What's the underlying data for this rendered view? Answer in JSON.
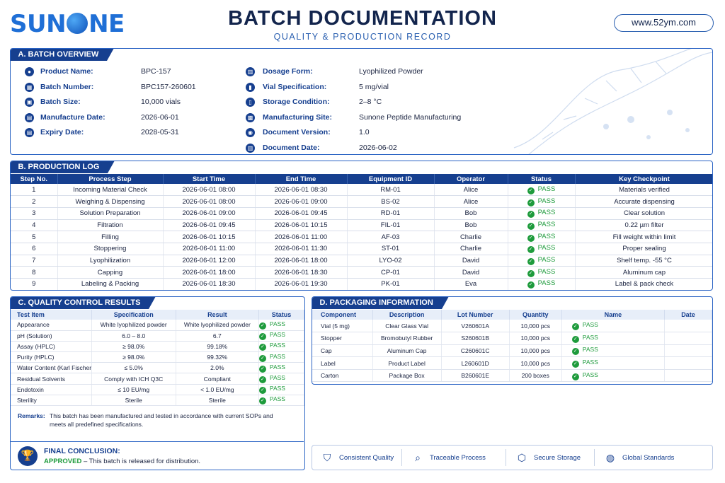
{
  "header": {
    "logo_text_1": "SUN",
    "logo_text_2": "NE",
    "title": "BATCH DOCUMENTATION",
    "subtitle": "QUALITY & PRODUCTION RECORD",
    "url": "www.52ym.com"
  },
  "overview": {
    "section_title": "A. BATCH OVERVIEW",
    "left": [
      {
        "icon": "person-icon",
        "label": "Product Name:",
        "value": "BPC-157"
      },
      {
        "icon": "barcode-icon",
        "label": "Batch Number:",
        "value": "BPC157-260601"
      },
      {
        "icon": "box-icon",
        "label": "Batch Size:",
        "value": "10,000 vials"
      },
      {
        "icon": "calendar-icon",
        "label": "Manufacture Date:",
        "value": "2026-06-01"
      },
      {
        "icon": "calendar-icon",
        "label": "Expiry Date:",
        "value": "2028-05-31"
      }
    ],
    "right": [
      {
        "icon": "document-icon",
        "label": "Dosage Form:",
        "value": "Lyophilized Powder"
      },
      {
        "icon": "vial-icon",
        "label": "Vial Specification:",
        "value": "5 mg/vial"
      },
      {
        "icon": "thermometer-icon",
        "label": "Storage Condition:",
        "value": "2–8 °C"
      },
      {
        "icon": "factory-icon",
        "label": "Manufacturing Site:",
        "value": "Sunone Peptide Manufacturing"
      },
      {
        "icon": "version-icon",
        "label": "Document Version:",
        "value": "1.0"
      },
      {
        "icon": "document-icon",
        "label": "Document Date:",
        "value": "2026-06-02"
      }
    ]
  },
  "production": {
    "section_title": "B. PRODUCTION LOG",
    "headers": [
      "Step No.",
      "Process Step",
      "Start Time",
      "End Time",
      "Equipment ID",
      "Operator",
      "Status",
      "Key Checkpoint"
    ],
    "rows": [
      [
        "1",
        "Incoming Material Check",
        "2026-06-01 08:00",
        "2026-06-01 08:30",
        "RM-01",
        "Alice",
        "PASS",
        "Materials verified"
      ],
      [
        "2",
        "Weighing & Dispensing",
        "2026-06-01 08:00",
        "2026-06-01 09:00",
        "BS-02",
        "Alice",
        "PASS",
        "Accurate dispensing"
      ],
      [
        "3",
        "Solution Preparation",
        "2026-06-01 09:00",
        "2026-06-01 09:45",
        "RD-01",
        "Bob",
        "PASS",
        "Clear solution"
      ],
      [
        "4",
        "Filtration",
        "2026-06-01 09:45",
        "2026-06-01 10:15",
        "FIL-01",
        "Bob",
        "PASS",
        "0.22 µm filter"
      ],
      [
        "5",
        "Filling",
        "2026-06-01 10:15",
        "2026-06-01 11:00",
        "AF-03",
        "Charlie",
        "PASS",
        "Fill weight within limit"
      ],
      [
        "6",
        "Stoppering",
        "2026-06-01 11:00",
        "2026-06-01 11:30",
        "ST-01",
        "Charlie",
        "PASS",
        "Proper sealing"
      ],
      [
        "7",
        "Lyophilization",
        "2026-06-01 12:00",
        "2026-06-01 18:00",
        "LYO-02",
        "David",
        "PASS",
        "Shelf temp. -55 °C"
      ],
      [
        "8",
        "Capping",
        "2026-06-01 18:00",
        "2026-06-01 18:30",
        "CP-01",
        "David",
        "PASS",
        "Aluminum cap"
      ],
      [
        "9",
        "Labeling & Packing",
        "2026-06-01 18:30",
        "2026-06-01 19:30",
        "PK-01",
        "Eva",
        "PASS",
        "Label & pack check"
      ]
    ]
  },
  "qc": {
    "section_title": "C. QUALITY CONTROL RESULTS",
    "headers": [
      "Test Item",
      "Specification",
      "Result",
      "Status"
    ],
    "rows": [
      [
        "Appearance",
        "White lyophilized powder",
        "White lyophilized powder",
        "PASS"
      ],
      [
        "pH (Solution)",
        "6.0 – 8.0",
        "6.7",
        "PASS"
      ],
      [
        "Assay (HPLC)",
        "≥ 98.0%",
        "99.18%",
        "PASS"
      ],
      [
        "Purity (HPLC)",
        "≥ 98.0%",
        "99.32%",
        "PASS"
      ],
      [
        "Water Content (Karl Fischer)",
        "≤ 5.0%",
        "2.0%",
        "PASS"
      ],
      [
        "Residual Solvents",
        "Comply with ICH Q3C",
        "Compliant",
        "PASS"
      ],
      [
        "Endotoxin",
        "≤ 10 EU/mg",
        "< 1.0 EU/mg",
        "PASS"
      ],
      [
        "Sterility",
        "Sterile",
        "Sterile",
        "PASS"
      ]
    ],
    "remarks_label": "Remarks:",
    "remarks_text": "This batch has been manufactured and tested in accordance with current SOPs and meets all predefined specifications.",
    "conclusion_title": "FINAL CONCLUSION:",
    "conclusion_status": "APPROVED",
    "conclusion_text": " – This batch is released for distribution."
  },
  "packaging": {
    "section_title": "D. PACKAGING INFORMATION",
    "headers": [
      "Component",
      "Description",
      "Lot Number",
      "Quantity",
      "Name",
      "Date"
    ],
    "rows": [
      [
        "Vial (5 mg)",
        "Clear Glass Vial",
        "V260601A",
        "10,000 pcs",
        "PASS"
      ],
      [
        "Stopper",
        "Bromobutyl Rubber",
        "S260601B",
        "10,000 pcs",
        "PASS"
      ],
      [
        "Cap",
        "Aluminum Cap",
        "C260601C",
        "10,000 pcs",
        "PASS"
      ],
      [
        "Label",
        "Product Label",
        "L260601D",
        "10,000 pcs",
        "PASS"
      ],
      [
        "Carton",
        "Package Box",
        "B260601E",
        "200 boxes",
        "PASS"
      ]
    ]
  },
  "features": [
    {
      "icon": "shield-check-icon",
      "label": "Consistent Quality"
    },
    {
      "icon": "magnifier-icon",
      "label": "Traceable Process"
    },
    {
      "icon": "cube-icon",
      "label": "Secure Storage"
    },
    {
      "icon": "globe-icon",
      "label": "Global Standards"
    }
  ],
  "colors": {
    "navy": "#163f8f",
    "accent": "#2a63c4",
    "pass": "#1e9b3c",
    "title": "#13254d"
  }
}
